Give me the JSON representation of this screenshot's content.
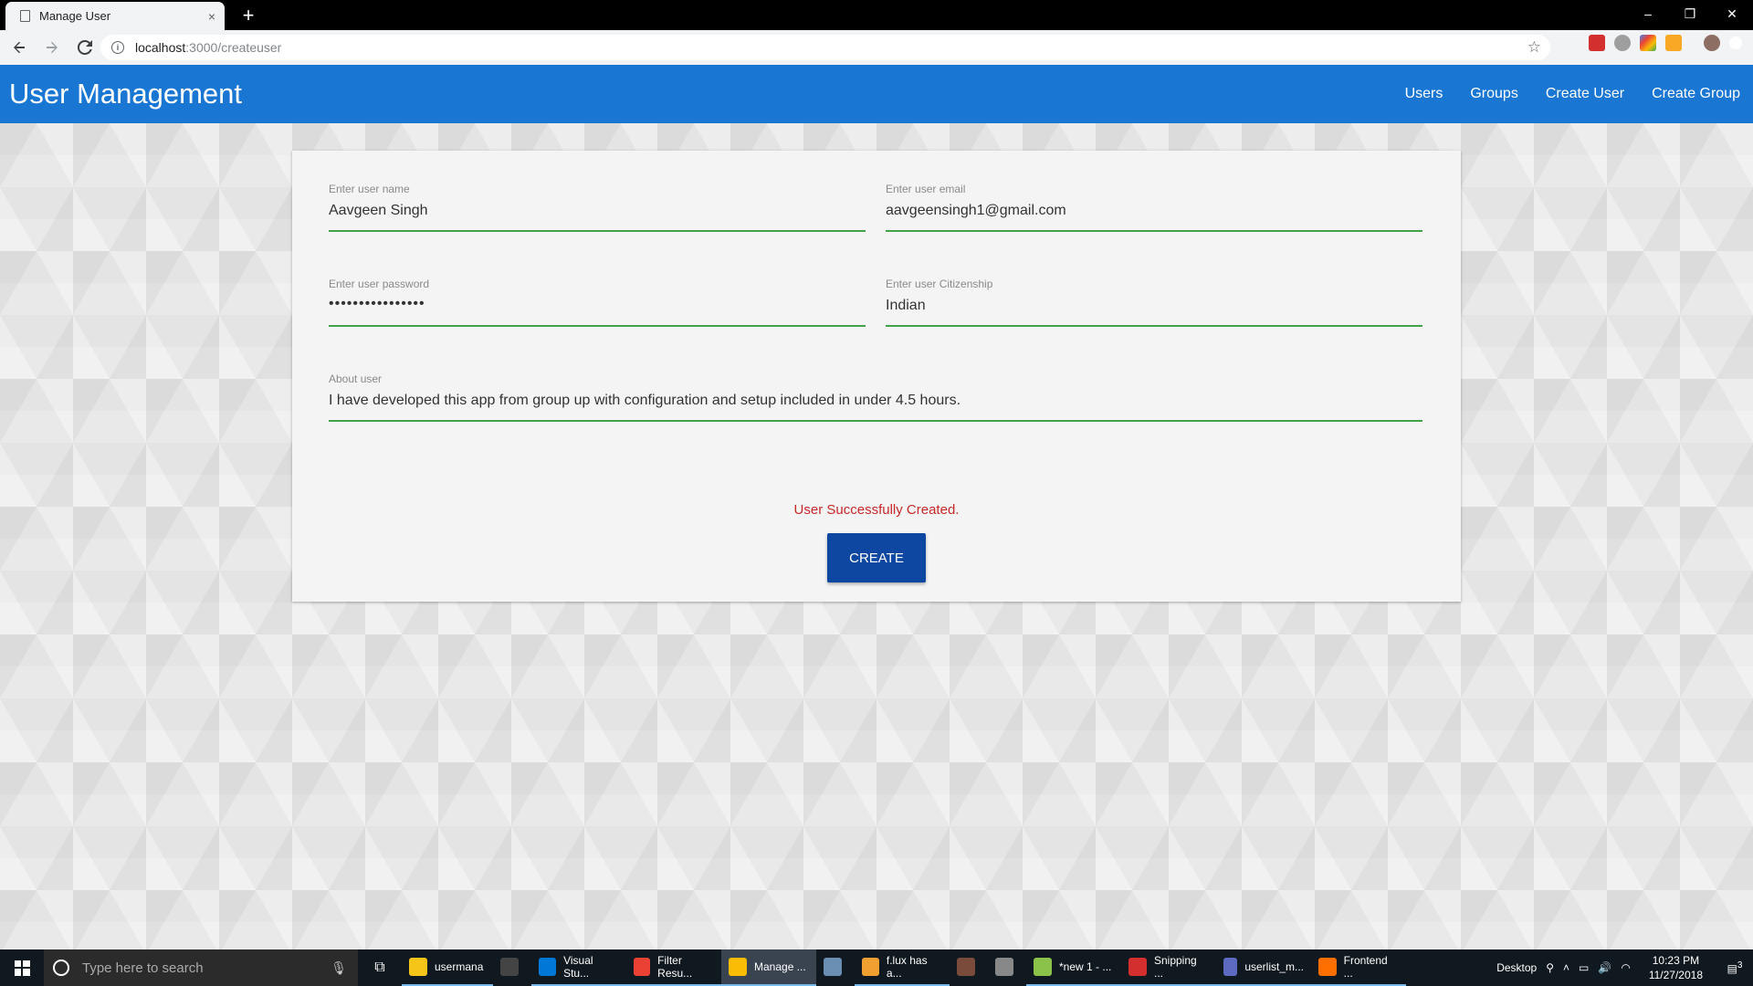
{
  "browser": {
    "tab_title": "Manage User",
    "tab_close": "×",
    "new_tab": "+",
    "url_host": "localhost",
    "url_rest": ":3000/createuser",
    "window_controls": [
      "–",
      "❐",
      "✕"
    ]
  },
  "app": {
    "title": "User Management",
    "nav": [
      "Users",
      "Groups",
      "Create User",
      "Create Group"
    ]
  },
  "form": {
    "name": {
      "label": "Enter user name",
      "value": "Aavgeen Singh"
    },
    "email": {
      "label": "Enter user email",
      "value": "aavgeensingh1@gmail.com"
    },
    "password": {
      "label": "Enter user password",
      "value": "••••••••••••••••"
    },
    "citizenship": {
      "label": "Enter user Citizenship",
      "value": "Indian"
    },
    "about": {
      "label": "About user",
      "value": "I have developed this app from group up with configuration and setup included in under 4.5 hours."
    },
    "status": "User Successfully Created.",
    "submit_label": "CREATE",
    "line_color": "#43a047",
    "status_color": "#c62828",
    "button_color": "#0d47a1"
  },
  "header_color": "#1976d2",
  "taskbar": {
    "search_placeholder": "Type here to search",
    "items": [
      {
        "label": "usermana",
        "color": "#f5c518"
      },
      {
        "label": "",
        "color": "#444"
      },
      {
        "label": "Visual Stu...",
        "color": "#0078d7"
      },
      {
        "label": "Filter Resu...",
        "color": "#e94235"
      },
      {
        "label": "Manage ...",
        "color": "#fbbc05"
      },
      {
        "label": "",
        "color": "#6b8fb3"
      },
      {
        "label": "f.lux has a...",
        "color": "#f0a030"
      },
      {
        "label": "",
        "color": "#7a4b3a"
      },
      {
        "label": "",
        "color": "#888"
      },
      {
        "label": "*new 1 - ...",
        "color": "#8bc34a"
      },
      {
        "label": "Snipping ...",
        "color": "#d32f2f"
      },
      {
        "label": "userlist_m...",
        "color": "#5c6bc0"
      },
      {
        "label": "Frontend ...",
        "color": "#ff6f00"
      }
    ],
    "desktop_label": "Desktop",
    "time": "10:23 PM",
    "date": "11/27/2018",
    "notification_count": "3"
  }
}
